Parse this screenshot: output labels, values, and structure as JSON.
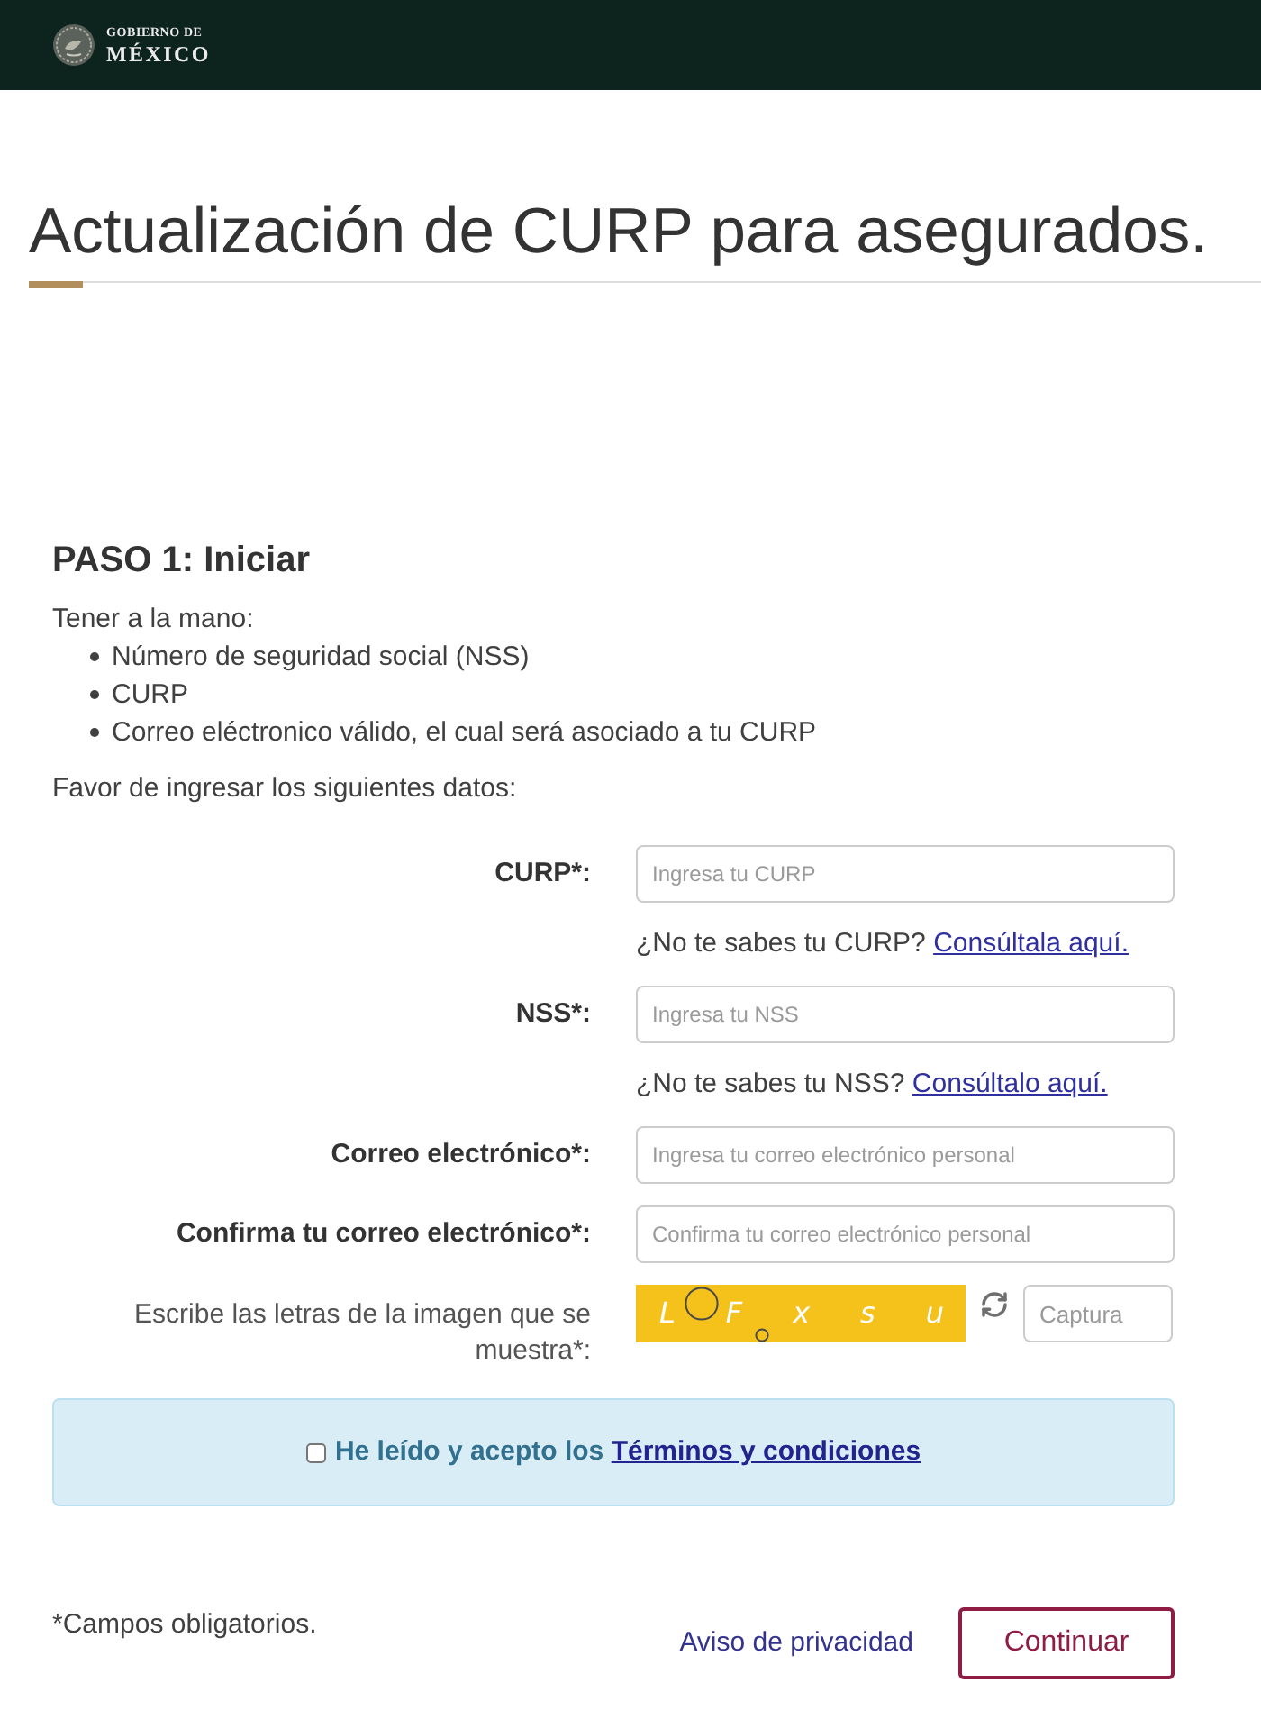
{
  "header": {
    "logo_top": "GOBIERNO DE",
    "logo_bottom": "MÉXICO"
  },
  "title": "Actualización de CURP para asegurados.",
  "step": {
    "heading": "PASO 1: Iniciar",
    "intro": "Tener a la mano:",
    "items": [
      "Número de seguridad social (NSS)",
      "CURP",
      "Correo eléctronico válido, el cual será asociado a tu CURP"
    ],
    "instruction": "Favor de ingresar los siguientes datos:"
  },
  "form": {
    "fields": [
      {
        "kind": "text",
        "label": "CURP*:",
        "placeholder": "Ingresa tu CURP",
        "hint": "¿No te sabes tu CURP?",
        "hint_link": "Consúltala aquí."
      },
      {
        "kind": "text",
        "label": "NSS*:",
        "placeholder": "Ingresa tu NSS",
        "hint": "¿No te sabes tu NSS?",
        "hint_link": "Consúltalo aquí."
      },
      {
        "kind": "text",
        "label": "Correo electrónico*:",
        "placeholder": "Ingresa tu correo electrónico personal"
      },
      {
        "kind": "text",
        "label": "Confirma tu correo electrónico*:",
        "placeholder": "Confirma tu correo electrónico personal"
      },
      {
        "kind": "captcha",
        "label": "Escribe las letras de la imagen que se muestra*:",
        "captcha_letters": [
          "L",
          "F",
          "x",
          "s",
          "u"
        ],
        "placeholder": "Captura"
      }
    ]
  },
  "terms": {
    "checked": false,
    "text": "He leído y acepto los",
    "link": "Términos y condiciones"
  },
  "footer": {
    "required_note": "*Campos obligatorios.",
    "privacy_link": "Aviso de privacidad",
    "continue_button": "Continuar"
  }
}
